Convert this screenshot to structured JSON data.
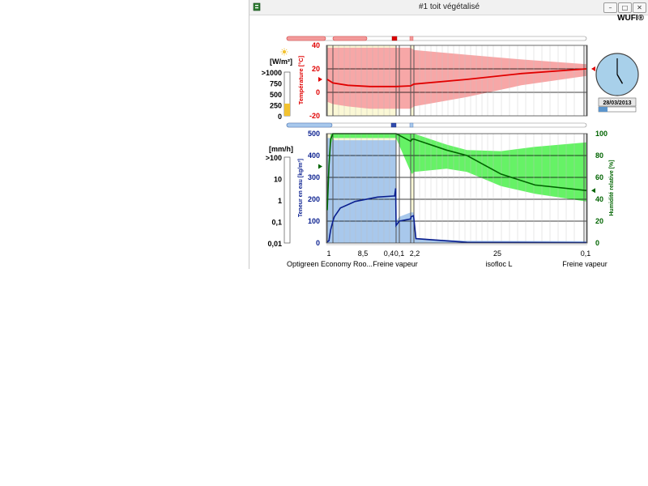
{
  "window": {
    "title": "#1 toit végétalisé",
    "brand": "WUFI®",
    "buttons": {
      "minimize": "–",
      "maximize": "□",
      "close": "✕"
    }
  },
  "radiation_scale": {
    "unit": "[W/m²]",
    "ticks": [
      ">1000",
      "750",
      "500",
      "250",
      "0"
    ],
    "level": 0.28,
    "color": "#f2c230",
    "sun_color": "#f2c230"
  },
  "rain_scale": {
    "unit": "[mm/h]",
    "ticks": [
      ">100",
      "10",
      "1",
      "0,1",
      "0,01"
    ]
  },
  "clock": {
    "date": "28/03/2013",
    "hour": 5,
    "minute": 0,
    "progress": 0.24,
    "face_color": "#a8d0ea"
  },
  "colors": {
    "temperature": "#e00000",
    "temperature_band": "#f7a7a7",
    "water": "#0a1f8f",
    "water_band": "#a8c8ec",
    "humidity": "#006400",
    "humidity_band": "#66f266",
    "layer_fill": "#fbf8d6",
    "grid": "#000000"
  },
  "top_chart": {
    "ylabel": "Température [°C]",
    "ticks": [
      "40",
      "20",
      "0",
      "-20"
    ],
    "ylim": [
      -20,
      40
    ]
  },
  "bottom_chart": {
    "ylabel_left": "Teneur en eau [kg/m³]",
    "ylabel_right": "Humidité relative [%]",
    "ticks_left": [
      "500",
      "400",
      "300",
      "200",
      "100",
      "0"
    ],
    "ticks_right": [
      "100",
      "80",
      "60",
      "40",
      "20",
      "0"
    ],
    "ylim_left": [
      0,
      500
    ],
    "ylim_right": [
      0,
      100
    ]
  },
  "layers": {
    "thickness_labels": [
      "1",
      "8,5",
      "0,4",
      "0,1",
      "2,2",
      "25",
      "0,1"
    ],
    "material_labels": [
      "Optigreen Economy Roo...",
      "Freine vapeur",
      "isofloc L",
      "Freine vapeur"
    ]
  },
  "chart_data": {
    "type": "line",
    "x_unit": "cm",
    "layer_boundaries": [
      0,
      1,
      9.5,
      9.9,
      10,
      12.2,
      37.2,
      37.3
    ],
    "temperature": {
      "x": [
        0,
        1,
        3,
        6,
        9.5,
        10,
        12.2,
        20,
        28,
        37.3
      ],
      "current": [
        11,
        8,
        6,
        5,
        5,
        5.5,
        7,
        11,
        16,
        20
      ],
      "min": [
        -8,
        -10,
        -12,
        -14,
        -14,
        -14,
        -12,
        -4,
        6,
        14
      ],
      "max": [
        38,
        38,
        38,
        38,
        38,
        38,
        36,
        32,
        28,
        24
      ]
    },
    "water_content": {
      "x": [
        0,
        0.3,
        0.6,
        1,
        1.2,
        2,
        4,
        7,
        9.3,
        9.45,
        9.5,
        9.9,
        10,
        10.3,
        12.0,
        12.2,
        12.5,
        20,
        37.3
      ],
      "current": [
        5,
        10,
        60,
        100,
        120,
        160,
        190,
        210,
        215,
        250,
        80,
        100,
        110,
        120,
        125,
        110,
        20,
        3,
        2
      ],
      "max": [
        480,
        480,
        480,
        480,
        470,
        470,
        470,
        470,
        470,
        470,
        100,
        120,
        140,
        140,
        140,
        140,
        20,
        10,
        8
      ]
    },
    "relative_humidity": {
      "x": [
        0,
        0.3,
        0.6,
        1,
        9.5,
        10,
        11,
        12.2,
        17,
        20,
        25,
        30,
        37.3
      ],
      "current": [
        30,
        70,
        95,
        100,
        100,
        93,
        95,
        95,
        85,
        80,
        63,
        53,
        48
      ],
      "min": [
        20,
        60,
        90,
        96,
        96,
        65,
        63,
        65,
        68,
        65,
        52,
        45,
        38
      ],
      "max": [
        40,
        80,
        100,
        100,
        100,
        100,
        100,
        100,
        90,
        85,
        84,
        88,
        92
      ]
    }
  }
}
